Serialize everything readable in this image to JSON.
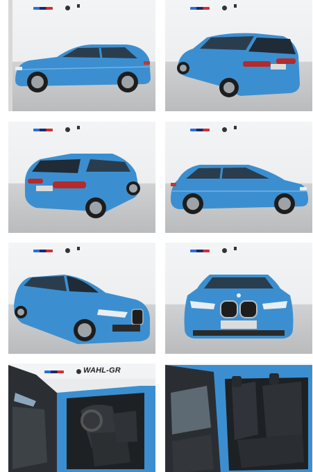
{
  "gallery": {
    "dealer_text": "WAHL-GR",
    "car_color": "#3b8fd0",
    "photos": [
      {
        "name": "car-side-left"
      },
      {
        "name": "car-rear-three-quarter-left"
      },
      {
        "name": "car-rear-three-quarter-right"
      },
      {
        "name": "car-side-right"
      },
      {
        "name": "car-front-three-quarter-right"
      },
      {
        "name": "car-front"
      },
      {
        "name": "interior-front-seats"
      },
      {
        "name": "interior-rear-seats"
      }
    ]
  }
}
